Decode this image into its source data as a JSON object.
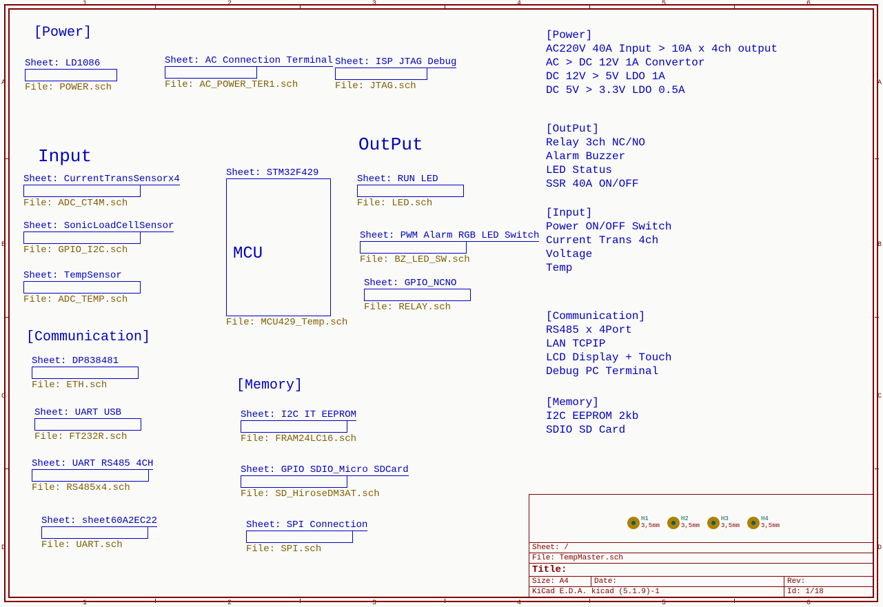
{
  "ruler": {
    "numbers": [
      "1",
      "2",
      "3",
      "4",
      "5",
      "6"
    ],
    "letters": [
      "A",
      "B",
      "C",
      "D"
    ]
  },
  "sections": {
    "power_hdr": "[Power]",
    "input_hdr": "Input",
    "output_hdr": "OutPut",
    "comm_hdr": "[Communication]",
    "memory_hdr": "[Memory]"
  },
  "sheets": {
    "ld1086": {
      "sheet": "Sheet: LD1086",
      "file": "File: POWER.sch"
    },
    "acconn": {
      "sheet": "Sheet: AC Connection Terminal",
      "file": "File: AC_POWER_TER1.sch"
    },
    "jtag": {
      "sheet": "Sheet: ISP JTAG Debug",
      "file": "File: JTAG.sch"
    },
    "ct": {
      "sheet": "Sheet: CurrentTransSensorx4",
      "file": "File: ADC_CT4M.sch"
    },
    "sonic": {
      "sheet": "Sheet: SonicLoadCellSensor",
      "file": "File: GPIO_I2C.sch"
    },
    "temp": {
      "sheet": "Sheet: TempSensor",
      "file": "File: ADC_TEMP.sch"
    },
    "mcu": {
      "sheet": "Sheet: STM32F429",
      "file": "File: MCU429_Temp.sch",
      "label": "MCU"
    },
    "runled": {
      "sheet": "Sheet: RUN LED",
      "file": "File: LED.sch"
    },
    "pwm": {
      "sheet": "Sheet: PWM Alarm RGB LED Switch",
      "file": "File: BZ_LED_SW.sch"
    },
    "ncno": {
      "sheet": "Sheet: GPIO_NCNO",
      "file": "File: RELAY.sch"
    },
    "dp": {
      "sheet": "Sheet: DP838481",
      "file": "File: ETH.sch"
    },
    "usb": {
      "sheet": "Sheet: UART USB",
      "file": "File: FT232R.sch"
    },
    "rs485": {
      "sheet": "Sheet: UART RS485 4CH",
      "file": "File: RS485x4.sch"
    },
    "s60": {
      "sheet": "Sheet: sheet60A2EC22",
      "file": "File: UART.sch"
    },
    "eeprom": {
      "sheet": "Sheet: I2C IT EEPROM",
      "file": "File: FRAM24LC16.sch"
    },
    "sdio": {
      "sheet": "Sheet: GPIO SDIO_Micro SDCard",
      "file": "File: SD_HiroseDM3AT.sch"
    },
    "spi": {
      "sheet": "Sheet: SPI Connection",
      "file": "File: SPI.sch"
    }
  },
  "notes": {
    "power_title": "[Power]",
    "power_l1": "AC220V 40A Input > 10A x 4ch output",
    "power_l2": "AC > DC 12V 1A Convertor",
    "power_l3": "DC 12V > 5V LDO 1A",
    "power_l4": "DC 5V > 3.3V LDO 0.5A",
    "output_title": "[OutPut]",
    "output_l1": "Relay 3ch NC/NO",
    "output_l2": "Alarm Buzzer",
    "output_l3": "LED Status",
    "output_l4": "SSR 40A ON/OFF",
    "input_title": "[Input]",
    "input_l1": "Power ON/OFF Switch",
    "input_l2": "Current Trans 4ch",
    "input_l3": "Voltage",
    "input_l4": "Temp",
    "comm_title": "[Communication]",
    "comm_l1": "RS485 x 4Port",
    "comm_l2": "LAN TCPIP",
    "comm_l3": "LCD Display + Touch",
    "comm_l4": "Debug PC Terminal",
    "mem_title": "[Memory]",
    "mem_l1": "I2C EEPROM 2kb",
    "mem_l2": "SDIO SD Card"
  },
  "holes": [
    {
      "ref": "H1",
      "size": "3,5mm"
    },
    {
      "ref": "H2",
      "size": "3,5mm"
    },
    {
      "ref": "H3",
      "size": "3,5mm"
    },
    {
      "ref": "H4",
      "size": "3,5mm"
    }
  ],
  "titleblock": {
    "sheet": "Sheet: /",
    "file": "File: TempMaster.sch",
    "title": "Title:",
    "size": "Size: A4",
    "date": "Date:",
    "rev": "Rev:",
    "kicad": "KiCad E.D.A.  kicad (5.1.9)-1",
    "id": "Id: 1/18"
  }
}
